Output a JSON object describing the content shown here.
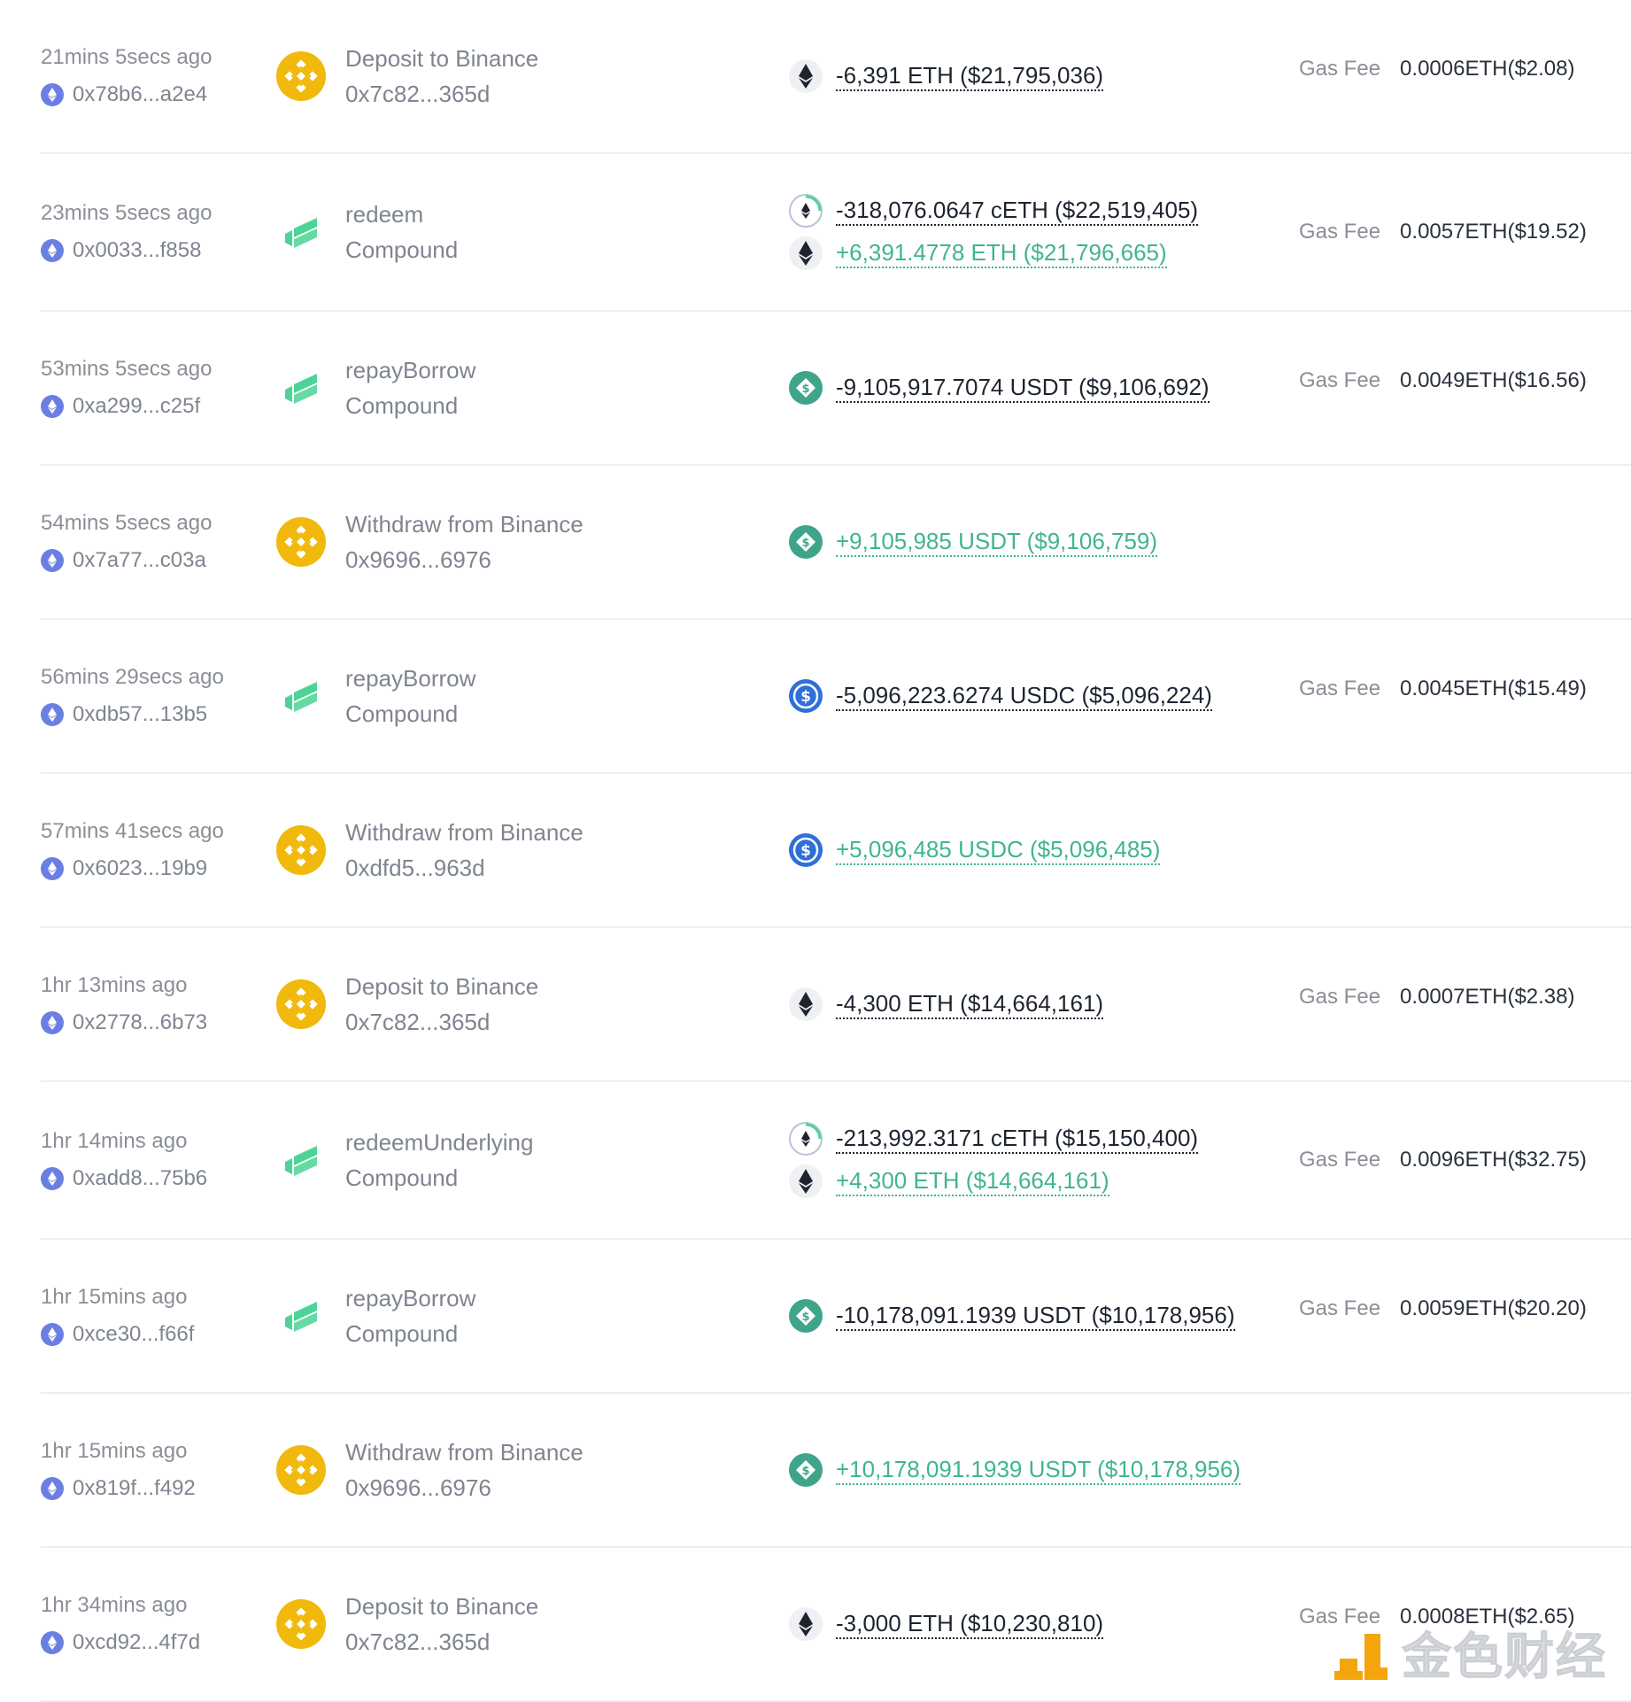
{
  "colors": {
    "negative": "#1d2430",
    "positive": "#3fb68b",
    "binance": "#f0b90b",
    "compound": "#4bd495",
    "tether": "#3fa58a",
    "usdc": "#2e6fd8",
    "eth_badge": "#6b7fe3"
  },
  "gas_label": "Gas Fee",
  "rows": [
    {
      "time": "21mins 5secs ago",
      "hash": "0x78b6...a2e4",
      "action": "Deposit to Binance",
      "sub": "0x7c82...365d",
      "protocol_icon": "binance-icon",
      "amounts": [
        {
          "text": "-6,391 ETH ($21,795,036)",
          "sign": "neg",
          "token_icon": "eth-icon"
        }
      ],
      "gas": "0.0006ETH($2.08)"
    },
    {
      "time": "23mins 5secs ago",
      "hash": "0x0033...f858",
      "action": "redeem",
      "sub": "Compound",
      "protocol_icon": "compound-icon",
      "amounts": [
        {
          "text": "-318,076.0647 cETH ($22,519,405)",
          "sign": "neg",
          "token_icon": "ceth-icon"
        },
        {
          "text": "+6,391.4778 ETH ($21,796,665)",
          "sign": "pos",
          "token_icon": "eth-icon"
        }
      ],
      "gas": "0.0057ETH($19.52)"
    },
    {
      "time": "53mins 5secs ago",
      "hash": "0xa299...c25f",
      "action": "repayBorrow",
      "sub": "Compound",
      "protocol_icon": "compound-icon",
      "amounts": [
        {
          "text": "-9,105,917.7074 USDT ($9,106,692)",
          "sign": "neg",
          "token_icon": "usdt-icon"
        }
      ],
      "gas": "0.0049ETH($16.56)"
    },
    {
      "time": "54mins 5secs ago",
      "hash": "0x7a77...c03a",
      "action": "Withdraw from Binance",
      "sub": "0x9696...6976",
      "protocol_icon": "binance-icon",
      "amounts": [
        {
          "text": "+9,105,985 USDT ($9,106,759)",
          "sign": "pos",
          "token_icon": "usdt-icon"
        }
      ],
      "gas": ""
    },
    {
      "time": "56mins 29secs ago",
      "hash": "0xdb57...13b5",
      "action": "repayBorrow",
      "sub": "Compound",
      "protocol_icon": "compound-icon",
      "amounts": [
        {
          "text": "-5,096,223.6274 USDC ($5,096,224)",
          "sign": "neg",
          "token_icon": "usdc-icon"
        }
      ],
      "gas": "0.0045ETH($15.49)"
    },
    {
      "time": "57mins 41secs ago",
      "hash": "0x6023...19b9",
      "action": "Withdraw from Binance",
      "sub": "0xdfd5...963d",
      "protocol_icon": "binance-icon",
      "amounts": [
        {
          "text": "+5,096,485 USDC ($5,096,485)",
          "sign": "pos",
          "token_icon": "usdc-icon"
        }
      ],
      "gas": ""
    },
    {
      "time": "1hr 13mins ago",
      "hash": "0x2778...6b73",
      "action": "Deposit to Binance",
      "sub": "0x7c82...365d",
      "protocol_icon": "binance-icon",
      "amounts": [
        {
          "text": "-4,300 ETH ($14,664,161)",
          "sign": "neg",
          "token_icon": "eth-icon"
        }
      ],
      "gas": "0.0007ETH($2.38)"
    },
    {
      "time": "1hr 14mins ago",
      "hash": "0xadd8...75b6",
      "action": "redeemUnderlying",
      "sub": "Compound",
      "protocol_icon": "compound-icon",
      "amounts": [
        {
          "text": "-213,992.3171 cETH ($15,150,400)",
          "sign": "neg",
          "token_icon": "ceth-icon"
        },
        {
          "text": "+4,300 ETH ($14,664,161)",
          "sign": "pos",
          "token_icon": "eth-icon"
        }
      ],
      "gas": "0.0096ETH($32.75)"
    },
    {
      "time": "1hr 15mins ago",
      "hash": "0xce30...f66f",
      "action": "repayBorrow",
      "sub": "Compound",
      "protocol_icon": "compound-icon",
      "amounts": [
        {
          "text": "-10,178,091.1939 USDT ($10,178,956)",
          "sign": "neg",
          "token_icon": "usdt-icon"
        }
      ],
      "gas": "0.0059ETH($20.20)"
    },
    {
      "time": "1hr 15mins ago",
      "hash": "0x819f...f492",
      "action": "Withdraw from Binance",
      "sub": "0x9696...6976",
      "protocol_icon": "binance-icon",
      "amounts": [
        {
          "text": "+10,178,091.1939 USDT ($10,178,956)",
          "sign": "pos",
          "token_icon": "usdt-icon"
        }
      ],
      "gas": ""
    },
    {
      "time": "1hr 34mins ago",
      "hash": "0xcd92...4f7d",
      "action": "Deposit to Binance",
      "sub": "0x7c82...365d",
      "protocol_icon": "binance-icon",
      "amounts": [
        {
          "text": "-3,000 ETH ($10,230,810)",
          "sign": "neg",
          "token_icon": "eth-icon"
        }
      ],
      "gas": "0.0008ETH($2.65)"
    }
  ],
  "watermark": {
    "text": "金色财经",
    "icon": "jinse-logo-icon"
  }
}
